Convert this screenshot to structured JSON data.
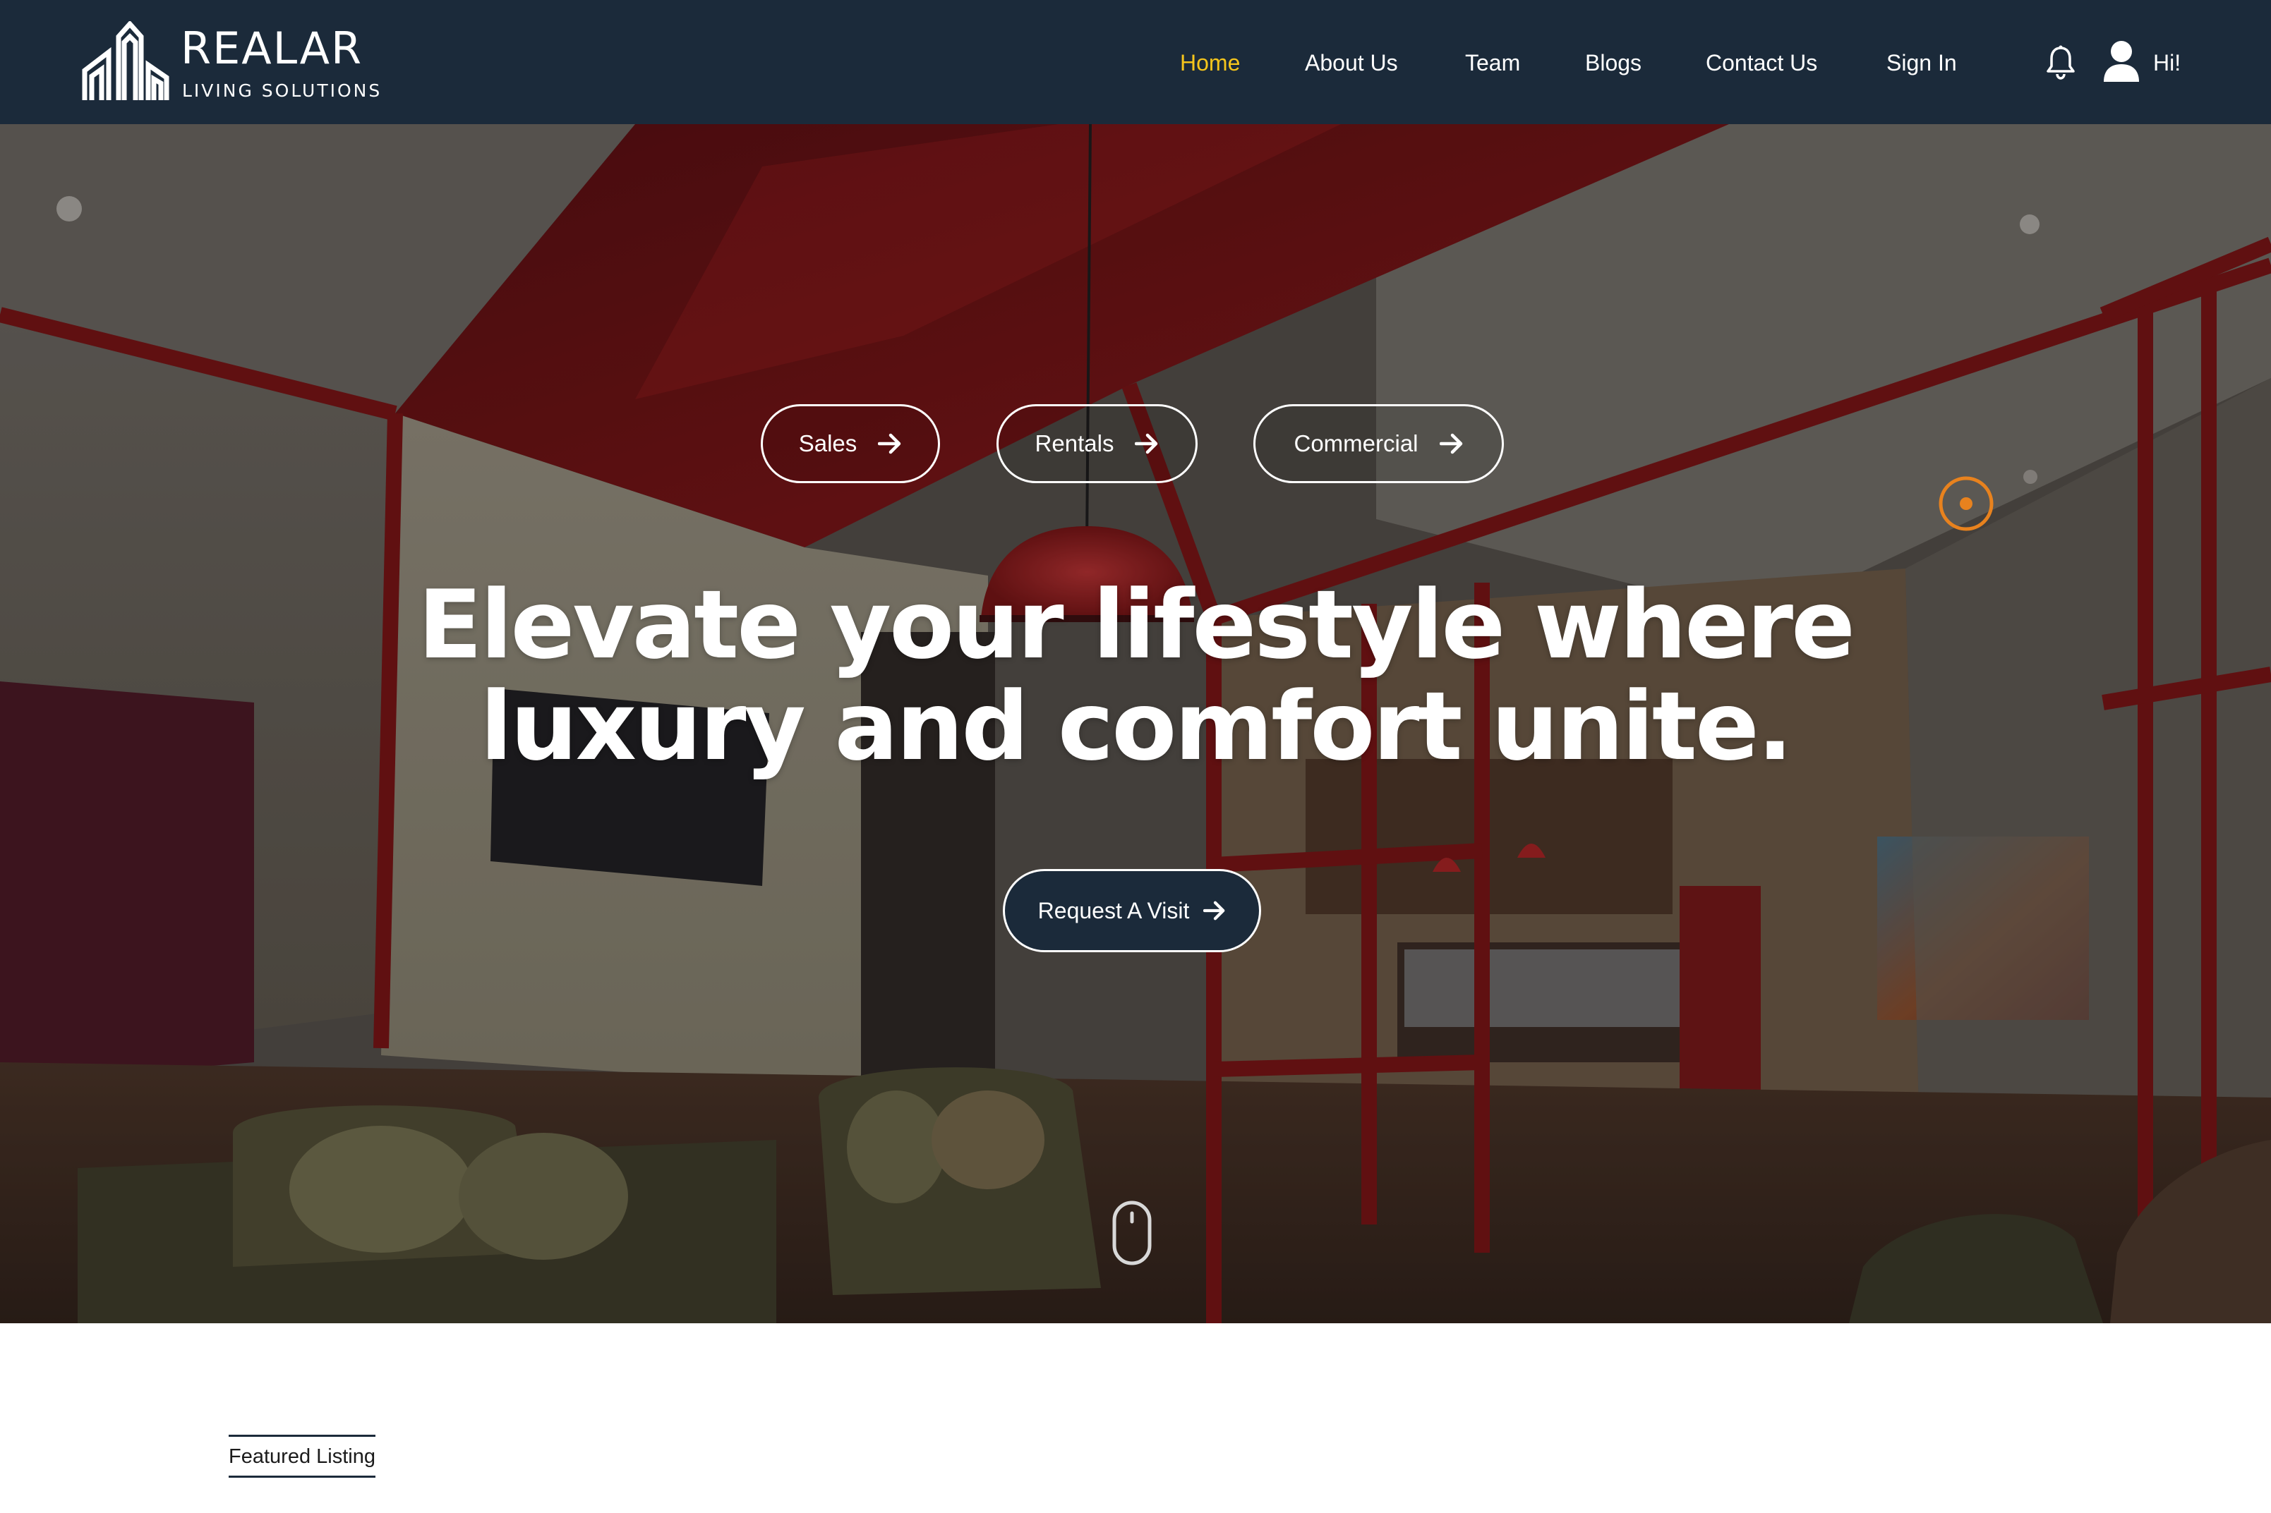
{
  "brand": {
    "name": "REALAR",
    "tagline": "LIVING SOLUTIONS",
    "logo_icon": "buildings-logo-icon"
  },
  "nav": {
    "items": [
      {
        "label": "Home",
        "active": true
      },
      {
        "label": "About Us",
        "active": false
      },
      {
        "label": "Team",
        "active": false
      },
      {
        "label": "Blogs",
        "active": false
      },
      {
        "label": "Contact Us",
        "active": false
      },
      {
        "label": "Sign In",
        "active": false
      }
    ],
    "notification_icon": "bell-icon",
    "user_icon": "user-icon",
    "greeting": "Hi!"
  },
  "hero": {
    "categories": [
      {
        "label": "Sales",
        "icon": "arrow-right-icon"
      },
      {
        "label": "Rentals",
        "icon": "arrow-right-icon"
      },
      {
        "label": "Commercial",
        "icon": "arrow-right-icon"
      }
    ],
    "headline_line1": "Elevate your lifestyle where",
    "headline_line2": "luxury and comfort unite.",
    "cta_label": "Request A Visit",
    "cta_icon": "arrow-right-icon",
    "scroll_icon": "mouse-scroll-icon",
    "pointer_icon": "target-ring-icon"
  },
  "section": {
    "eyebrow": "Featured Listing"
  },
  "colors": {
    "header_bg": "#1b2a3a",
    "nav_active": "#f5c51c",
    "pointer_ring": "#e8821e",
    "text_light": "#ffffff"
  }
}
